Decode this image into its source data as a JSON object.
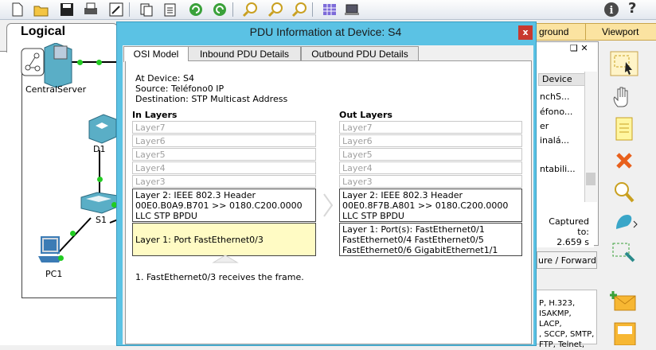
{
  "toolbar": {
    "icons": [
      "new-file-icon",
      "open-folder-icon",
      "save-icon",
      "print-icon",
      "activity-wizard-icon",
      "copy-icon",
      "paste-icon",
      "undo-icon",
      "redo-icon",
      "zoom-in-icon",
      "zoom-reset-icon",
      "zoom-out-icon",
      "palette-icon",
      "custom-device-icon",
      "info-icon",
      "help-icon"
    ],
    "help_label": "?"
  },
  "workspace": {
    "tab_label": "Logical",
    "devices": {
      "server": "CentralServer",
      "switch_d1": "D1",
      "switch_s1": "S1",
      "pc": "PC1"
    }
  },
  "right_panel": {
    "tab_background": "ground",
    "tab_viewport": "Viewport",
    "event_controls": "❑ ✕",
    "event_header": "Device",
    "event_rows": [
      "nchS...",
      "éfono...",
      "er",
      "inalá...",
      "",
      "ntabili...",
      ""
    ],
    "captured_label": "Captured to:",
    "captured_value": "2.659 s",
    "capture_button": "ure / Forward",
    "protocols": [
      "P, H.323,",
      "ISAKMP, LACP,",
      ", SCCP, SMTP,",
      "FTP, Telnet,"
    ]
  },
  "dialog": {
    "title": "PDU Information at Device: S4",
    "close_label": "x",
    "tabs": [
      "OSI Model",
      "Inbound PDU Details",
      "Outbound PDU Details"
    ],
    "at_device": "At Device: S4",
    "source": "Source: Teléfono0 IP",
    "destination": "Destination: STP Multicast Address",
    "in_layers_title": "In Layers",
    "out_layers_title": "Out Layers",
    "in_layers_dim": [
      "Layer7",
      "Layer6",
      "Layer5",
      "Layer4",
      "Layer3"
    ],
    "out_layers_dim": [
      "Layer7",
      "Layer6",
      "Layer5",
      "Layer4",
      "Layer3"
    ],
    "in_layer2": [
      "Layer 2: IEEE 802.3 Header",
      "00E0.B0A9.B701 >> 0180.C200.0000",
      "LLC STP BPDU"
    ],
    "in_layer1": "Layer 1: Port FastEthernet0/3",
    "out_layer2": [
      "Layer 2: IEEE 802.3 Header",
      "00E0.8F7B.A801 >> 0180.C200.0000",
      "LLC STP BPDU"
    ],
    "out_layer1": [
      "Layer 1: Port(s): FastEthernet0/1",
      "FastEthernet0/4 FastEthernet0/5",
      "FastEthernet0/6 GigabitEthernet1/1"
    ],
    "description": "1. FastEthernet0/3 receives the frame."
  },
  "colors": {
    "dialog_title_bar": "#5bc2e4",
    "close_button": "#c8392f",
    "highlight_layer": "#fffbc4",
    "link_dot": "#22cc22",
    "tab_orange": "#fbe3a1"
  }
}
